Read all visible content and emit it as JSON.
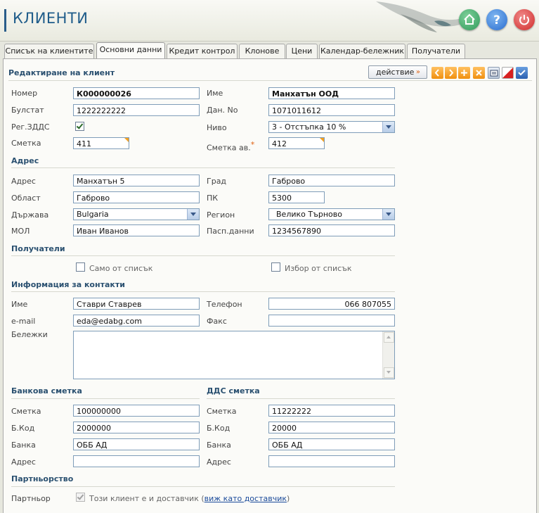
{
  "header": {
    "title": "КЛИЕНТИ",
    "icons": [
      "home-icon",
      "help-icon",
      "power-icon"
    ],
    "colors": {
      "home": "#2f9a5a",
      "help": "#2a6dd0",
      "power": "#d02a2a"
    }
  },
  "tabs": [
    "Списък на клиентите",
    "Основни данни",
    "Кредит контрол",
    "Клонове",
    "Цени",
    "Календар-бележник",
    "Получатели"
  ],
  "active_tab": "Основни данни",
  "edit": {
    "heading": "Редактиране на клиент",
    "action_label": "действие",
    "action_chevron": "»",
    "toolbar_icons": [
      "prev-icon",
      "next-icon",
      "add-icon",
      "delete-icon",
      "print-icon",
      "cancel-icon",
      "confirm-icon"
    ]
  },
  "main": {
    "number_label": "Номер",
    "number_value": "К000000026",
    "name_label": "Име",
    "name_value": "Манхатън ООД",
    "bulstat_label": "Булстат",
    "bulstat_value": "1222222222",
    "tax_no_label": "Дан. No",
    "tax_no_value": "1071011612",
    "vat_label": "Рег.ЗДДС",
    "vat_checked": true,
    "level_label": "Ниво",
    "level_value": "3 - Отстъпка 10 %",
    "account_label": "Сметка",
    "account_value": "411",
    "advance_account_label": "Сметка ав.",
    "advance_required": "*",
    "advance_account_value": "412"
  },
  "address": {
    "heading": "Адрес",
    "address_label": "Адрес",
    "address_value": "Манхатън 5",
    "city_label": "Град",
    "city_value": "Габрово",
    "district_label": "Област",
    "district_value": "Габрово",
    "postcode_label": "ПК",
    "postcode_value": "5300",
    "country_label": "Държава",
    "country_value": "Bulgaria",
    "region_label": "Регион",
    "region_value": "Велико Търново",
    "mol_label": "МОЛ",
    "mol_value": "Иван Иванов",
    "passport_label": "Пасп.данни",
    "passport_value": "1234567890"
  },
  "recipients": {
    "heading": "Получатели",
    "only_from_list": "Само от списък",
    "choose_from_list": "Избор от списък"
  },
  "contact": {
    "heading": "Информация за контакти",
    "name_label": "Име",
    "name_value": "Ставри Ставрев",
    "phone_label": "Телефон",
    "phone_value": "066 807055",
    "email_label": "e-mail",
    "email_value": "eda@edabg.com",
    "fax_label": "Факс",
    "fax_value": "",
    "notes_label": "Бележки",
    "notes_value": ""
  },
  "bank": {
    "heading": "Банкова сметка",
    "account_label": "Сметка",
    "account_value": "100000000",
    "code_label": "Б.Код",
    "code_value": "2000000",
    "bank_label": "Банка",
    "bank_value": "ОББ АД",
    "address_label": "Адрес",
    "address_value": ""
  },
  "vat_account": {
    "heading": "ДДС сметка",
    "account_label": "Сметка",
    "account_value": "11222222",
    "code_label": "Б.Код",
    "code_value": "20000",
    "bank_label": "Банка",
    "bank_value": "ОББ АД",
    "address_label": "Адрес",
    "address_value": ""
  },
  "partnership": {
    "heading": "Партньорство",
    "partner_label": "Партньор",
    "supplier_text": "Този клиент е и доставчик (",
    "supplier_link": "виж като доставчик",
    "supplier_close": ")"
  }
}
